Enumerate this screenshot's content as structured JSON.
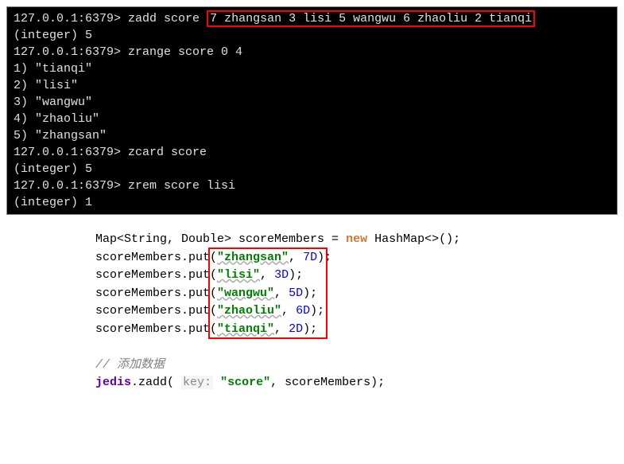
{
  "terminal": {
    "lines": [
      {
        "prompt": "127.0.0.1:6379> ",
        "cmd_pre": "zadd score ",
        "cmd_hl": "7 zhangsan 3 lisi 5 wangwu 6 zhaoliu 2 tianqi"
      },
      {
        "text": "(integer) 5"
      },
      {
        "prompt": "127.0.0.1:6379> ",
        "cmd_pre": "zrange score 0 4"
      },
      {
        "text": "1) \"tianqi\""
      },
      {
        "text": "2) \"lisi\""
      },
      {
        "text": "3) \"wangwu\""
      },
      {
        "text": "4) \"zhaoliu\""
      },
      {
        "text": "5) \"zhangsan\""
      },
      {
        "prompt": "127.0.0.1:6379> ",
        "cmd_pre": "zcard score"
      },
      {
        "text": "(integer) 5"
      },
      {
        "prompt": "127.0.0.1:6379> ",
        "cmd_pre": "zrem score lisi"
      },
      {
        "text": "(integer) 1"
      }
    ]
  },
  "code": {
    "decl": {
      "p1": "Map<String, Double> scoreMembers = ",
      "kw": "new",
      "p2": " HashMap<>();"
    },
    "puts": [
      {
        "prefix": "scoreMembers.put(",
        "key": "\"zhangsan\"",
        "sep": ", ",
        "val": "7D",
        "suffix": ");"
      },
      {
        "prefix": "scoreMembers.put(",
        "key": "\"lisi\"",
        "sep": ", ",
        "val": "3D",
        "suffix": ");"
      },
      {
        "prefix": "scoreMembers.put(",
        "key": "\"wangwu\"",
        "sep": ", ",
        "val": "5D",
        "suffix": ");"
      },
      {
        "prefix": "scoreMembers.put(",
        "key": "\"zhaoliu\"",
        "sep": ", ",
        "val": "6D",
        "suffix": ");"
      },
      {
        "prefix": "scoreMembers.put(",
        "key": "\"tianqi\"",
        "sep": ", ",
        "val": "2D",
        "suffix": ");"
      }
    ],
    "comment": "// 添加数据",
    "zadd": {
      "obj": "jedis",
      "p1": ".zadd( ",
      "hint": "key:",
      "p2": " ",
      "key": "\"score\"",
      "p3": ", scoreMembers);"
    }
  }
}
